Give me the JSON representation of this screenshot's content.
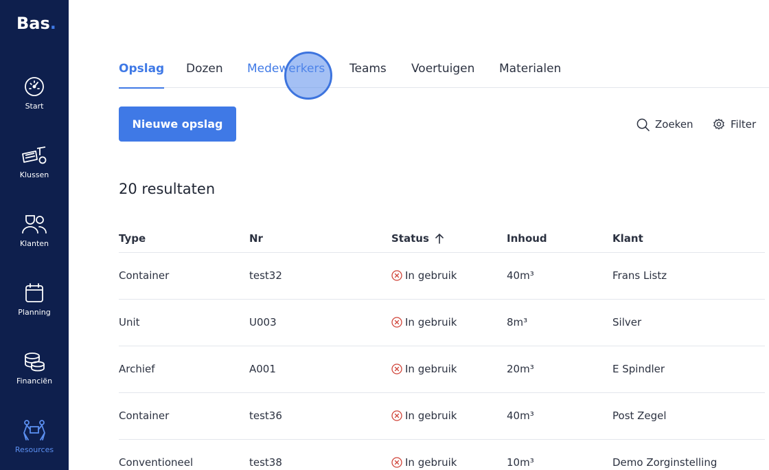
{
  "app": {
    "logo": "Bas",
    "logo_dot": "."
  },
  "sidebar": {
    "items": [
      {
        "label": "Start",
        "icon": "dashboard-gauge-icon",
        "active": false
      },
      {
        "label": "Klussen",
        "icon": "container-truck-icon",
        "active": false
      },
      {
        "label": "Klanten",
        "icon": "customers-icon",
        "active": false
      },
      {
        "label": "Planning",
        "icon": "calendar-icon",
        "active": false
      },
      {
        "label": "Financiën",
        "icon": "coins-stack-icon",
        "active": false
      },
      {
        "label": "Resources",
        "icon": "movers-icon",
        "active": true
      }
    ],
    "active_color": "#5b8ff0",
    "background": "#0e1f4d"
  },
  "tabs": [
    {
      "label": "Opslag",
      "active": true
    },
    {
      "label": "Dozen",
      "active": false
    },
    {
      "label": "Medewerkers",
      "active": false,
      "hovered": true
    },
    {
      "label": "Teams",
      "active": false
    },
    {
      "label": "Voertuigen",
      "active": false
    },
    {
      "label": "Materialen",
      "active": false
    }
  ],
  "toolbar": {
    "new_button": "Nieuwe opslag",
    "search_label": "Zoeken",
    "filter_label": "Filter"
  },
  "results_label": "20 resultaten",
  "table": {
    "columns": [
      "Type",
      "Nr",
      "Status",
      "Inhoud",
      "Klant"
    ],
    "sort_column": "Status",
    "sort_direction": "ascending",
    "rows": [
      {
        "type": "Container",
        "nr": "test32",
        "status": "In gebruik",
        "inhoud": "40m³",
        "klant": "Frans Listz"
      },
      {
        "type": "Unit",
        "nr": "U003",
        "status": "In gebruik",
        "inhoud": "8m³",
        "klant": "Silver"
      },
      {
        "type": "Archief",
        "nr": "A001",
        "status": "In gebruik",
        "inhoud": "20m³",
        "klant": "E Spindler"
      },
      {
        "type": "Container",
        "nr": "test36",
        "status": "In gebruik",
        "inhoud": "40m³",
        "klant": "Post Zegel"
      },
      {
        "type": "Conventioneel",
        "nr": "test38",
        "status": "In gebruik",
        "inhoud": "10m³",
        "klant": "Demo Zorginstelling"
      }
    ]
  },
  "colors": {
    "accent": "#3f79e6",
    "status_in_use": "#d0453a"
  }
}
